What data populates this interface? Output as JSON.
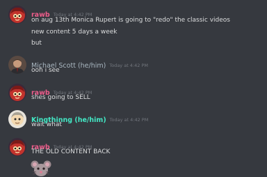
{
  "colors": {
    "background": "#36393f",
    "text": "#dcddde",
    "timestamp": "#72767d",
    "rawb": "#ee5d8b",
    "michael_scott": "#aab8c2",
    "kingthinng": "#43e8c5"
  },
  "messages": [
    {
      "author": "rawb",
      "timestamp": "Today at 4:42 PM",
      "lines": [
        "on aug 13th Monica Rupert is going to \"redo\" the classic videos",
        "new content 5 days a week",
        "but"
      ]
    },
    {
      "author": "Michael Scott (he/him)",
      "timestamp": "Today at 4:42 PM",
      "lines": [
        "ooh i see"
      ]
    },
    {
      "author": "rawb",
      "timestamp": "Today at 4:42 PM",
      "lines": [
        "shes going to SELL"
      ]
    },
    {
      "author": "Kingthinng (he/him)",
      "timestamp": "Today at 4:42 PM",
      "lines": [
        "wait what"
      ]
    },
    {
      "author": "rawb",
      "timestamp": "Today at 4:42 PM",
      "lines": [
        "THE OLD CONTENT BACK"
      ],
      "emoji": "mouse-face-emoji"
    }
  ]
}
